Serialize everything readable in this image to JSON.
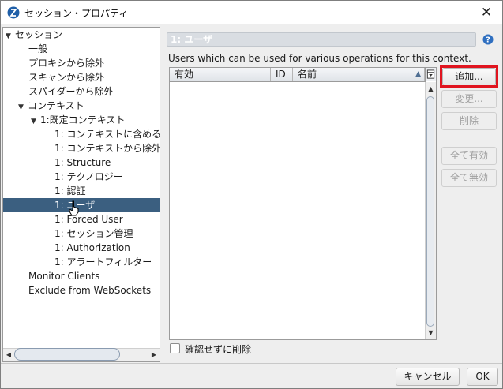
{
  "window": {
    "title": "セッション・プロパティ",
    "close_glyph": "✕"
  },
  "tree": {
    "items": [
      {
        "label": "セッション",
        "expandable": true
      },
      {
        "label": "一般"
      },
      {
        "label": "プロキシから除外"
      },
      {
        "label": "スキャンから除外"
      },
      {
        "label": "スパイダーから除外"
      },
      {
        "label": "コンテキスト",
        "expandable": true
      },
      {
        "label": "1:既定コンテキスト",
        "expandable": true
      },
      {
        "label": "1: コンテキストに含める"
      },
      {
        "label": "1: コンテキストから除外"
      },
      {
        "label": "1: Structure"
      },
      {
        "label": "1: テクノロジー"
      },
      {
        "label": "1: 認証"
      },
      {
        "label": "1: ユーザ",
        "selected": true
      },
      {
        "label": "1: Forced User"
      },
      {
        "label": "1: セッション管理"
      },
      {
        "label": "1: Authorization"
      },
      {
        "label": "1: アラートフィルター"
      },
      {
        "label": "Monitor Clients"
      },
      {
        "label": "Exclude from WebSockets"
      }
    ],
    "scroll_left_glyph": "◀",
    "scroll_right_glyph": "▶"
  },
  "panel": {
    "title": "1: ユーザ",
    "description": "Users which can be used for various operations for this context.",
    "table": {
      "columns": [
        "有効",
        "ID",
        "名前"
      ],
      "sort_glyph": "▲",
      "rows": []
    },
    "scroll_up_glyph": "▲",
    "scroll_down_glyph": "▼"
  },
  "side_buttons": {
    "add": "追加...",
    "modify": "変更...",
    "remove": "削除",
    "enable_all": "全て有効",
    "disable_all": "全て無効"
  },
  "confirm_remove_label": "確認せずに削除",
  "footer": {
    "cancel": "キャンセル",
    "ok": "OK"
  },
  "colors": {
    "selection": "#3b5f80",
    "highlight": "#e0141f"
  },
  "icons": [
    "app-icon",
    "close-icon",
    "help-icon",
    "column-chooser-icon",
    "mouse-cursor-icon"
  ]
}
